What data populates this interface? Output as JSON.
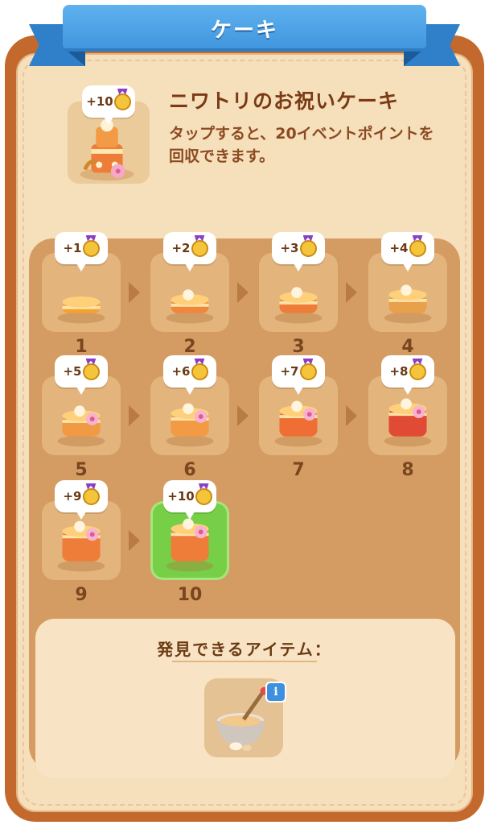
{
  "banner": {
    "title": "ケーキ"
  },
  "header": {
    "title": "ニワトリのお祝いケーキ",
    "description": "タップすると、20イベントポイントを回収できます。",
    "badge": "+10"
  },
  "levels": [
    {
      "number": "1",
      "badge": "+1",
      "icon": "fried-egg-icon"
    },
    {
      "number": "2",
      "badge": "+2",
      "icon": "cream-tart-icon"
    },
    {
      "number": "3",
      "badge": "+3",
      "icon": "glazed-cake-icon"
    },
    {
      "number": "4",
      "badge": "+4",
      "icon": "fruit-tart-icon"
    },
    {
      "number": "5",
      "badge": "+5",
      "icon": "flower-sponge-cake-icon"
    },
    {
      "number": "6",
      "badge": "+6",
      "icon": "decorated-sponge-cake-icon"
    },
    {
      "number": "7",
      "badge": "+7",
      "icon": "layer-cake-icon"
    },
    {
      "number": "8",
      "badge": "+8",
      "icon": "chick-cake-icon"
    },
    {
      "number": "9",
      "badge": "+9",
      "icon": "tiered-flower-cake-icon"
    },
    {
      "number": "10",
      "badge": "+10",
      "icon": "chicken-celebration-cake-icon"
    }
  ],
  "items": {
    "title": "発見できるアイテム：",
    "item_icon": "mixing-bowl-whisk-icon",
    "info_label": "i"
  },
  "colors": {
    "frame": "#c3692d",
    "panel": "#f6dfbb",
    "grid": "#d49c63",
    "ribbon": "#4aa0e4",
    "active_tile": "#77cf47"
  }
}
